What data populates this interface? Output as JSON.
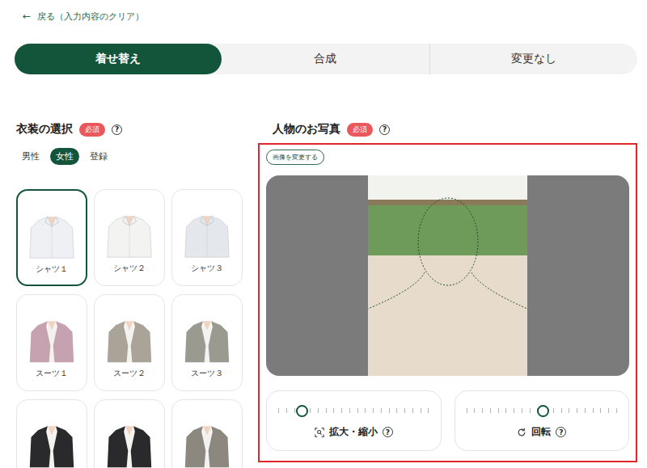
{
  "back_link": {
    "icon": "←",
    "label": "戻る（入力内容のクリア）"
  },
  "modes": [
    {
      "label": "着せ替え",
      "selected": true
    },
    {
      "label": "合成",
      "selected": false
    },
    {
      "label": "変更なし",
      "selected": false
    }
  ],
  "costume_panel": {
    "title": "衣装の選択",
    "badge": "必須",
    "help": "?",
    "genders": [
      {
        "label": "男性",
        "selected": false
      },
      {
        "label": "女性",
        "selected": true
      },
      {
        "label": "登録",
        "selected": false
      }
    ],
    "items": [
      {
        "label": "シャツ１",
        "selected": true,
        "kind": "shirt",
        "color": "#eef0f4"
      },
      {
        "label": "シャツ２",
        "selected": false,
        "kind": "shirt",
        "color": "#f3f3f1"
      },
      {
        "label": "シャツ３",
        "selected": false,
        "kind": "shirt",
        "color": "#e4e7ec"
      },
      {
        "label": "スーツ１",
        "selected": false,
        "kind": "suit",
        "color": "#c6a2b0"
      },
      {
        "label": "スーツ２",
        "selected": false,
        "kind": "suit",
        "color": "#a9a398"
      },
      {
        "label": "スーツ３",
        "selected": false,
        "kind": "suit",
        "color": "#9a9a90"
      },
      {
        "label": "",
        "selected": false,
        "kind": "suit",
        "color": "#2a2a2c"
      },
      {
        "label": "",
        "selected": false,
        "kind": "suit",
        "color": "#2a2a2c"
      },
      {
        "label": "",
        "selected": false,
        "kind": "suit",
        "color": "#8c8880"
      }
    ]
  },
  "photo_panel": {
    "title": "人物のお写真",
    "badge": "必須",
    "help": "?",
    "change_button": "画像を変更する",
    "controls": [
      {
        "label": "拡大・縮小",
        "help": "?",
        "level": 0.15,
        "kind": "zoom"
      },
      {
        "label": "回転",
        "help": "?",
        "level": 0.5,
        "kind": "rotate"
      }
    ]
  }
}
